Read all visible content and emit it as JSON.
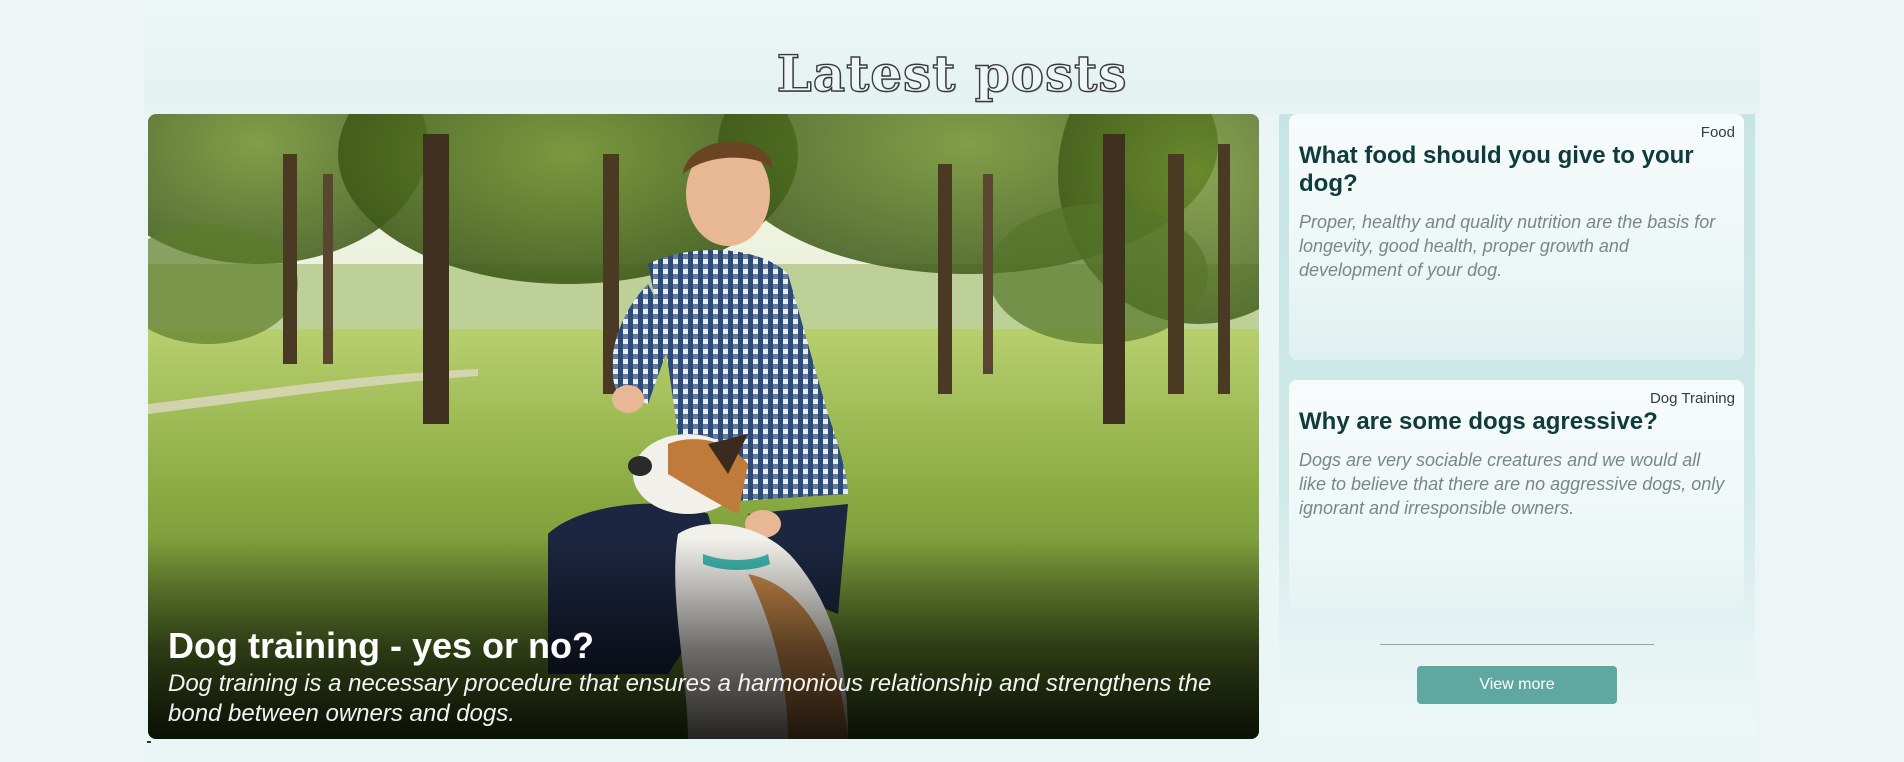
{
  "section": {
    "title": "Latest posts"
  },
  "featured_post": {
    "title": "Dog training - yes or no?",
    "excerpt": "Dog training is a necessary procedure that ensures a harmonious relationship and strengthens the bond between owners and dogs.",
    "image": "man-training-dog-in-park-photo"
  },
  "side_posts": [
    {
      "category": "Food",
      "title": "What food should you give to your dog?",
      "excerpt": "Proper, healthy and quality nutrition are the basis for longevity, good health, proper growth and development of your dog."
    },
    {
      "category": "Dog Training",
      "title": "Why are some dogs agressive?",
      "excerpt": "Dogs are very sociable creatures and we would all like to believe that there are no aggressive dogs, only ignorant and irresponsible owners."
    }
  ],
  "actions": {
    "view_more_label": "View more"
  },
  "colors": {
    "accent": "#5fa8a2",
    "title_text": "#0f3b3c",
    "background": "#eef7f6"
  }
}
